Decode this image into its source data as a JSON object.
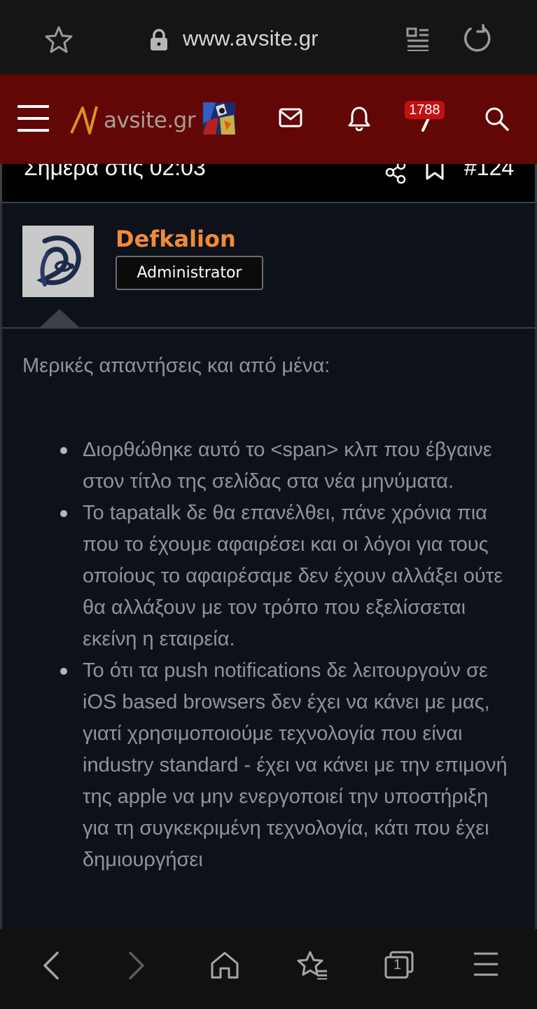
{
  "browser": {
    "url": "www.avsite.gr",
    "icons": [
      "star-icon",
      "lock-icon",
      "reader-icon",
      "reload-icon"
    ]
  },
  "header": {
    "logo_text": "avsite.gr",
    "notification_count": "1788",
    "icons": [
      "menu-icon",
      "logo-icon",
      "user-thumb",
      "mail-icon",
      "bell-icon",
      "whatsnew-icon",
      "search-icon"
    ],
    "colors": {
      "bar": "#620606",
      "badge": "#c21111",
      "logo_accent": "#e0901f"
    }
  },
  "post": {
    "date": "Σημερα στις 02:03",
    "number": "#124",
    "author": "Defkalion",
    "role": "Administrator",
    "author_color": "#f28a34",
    "intro": "Μερικές απαντήσεις και από μένα:",
    "bullets": [
      "Διορθώθηκε αυτό το <span> κλπ που έβγαινε στον τίτλο της σελίδας στα νέα μηνύματα.",
      "Το tapatalk δε θα επανέλθει, πάνε χρόνια πια που το έχουμε αφαιρέσει και οι λόγοι για τους οποίους το αφαιρέσαμε δεν έχουν αλλάξει ούτε θα αλλάξουν με τον τρόπο που εξελίσσεται εκείνη η εταιρεία.",
      "Το ότι τα push notifications δε λειτουργούν σε iOS based browsers δεν έχει να κάνει με μας, γιατί χρησιμοποιούμε τεχνολογία που είναι industry standard - έχει να κάνει με την επιμονή της apple να μην ενεργοποιεί την υποστήριξη για τη συγκεκριμένη τεχνολογία, κάτι που έχει δημιουργήσει"
    ]
  },
  "bottom_nav": {
    "tab_count": "1",
    "icons": [
      "back-icon",
      "forward-icon",
      "home-icon",
      "bookmarks-icon",
      "tabs-icon",
      "menu-icon"
    ]
  }
}
